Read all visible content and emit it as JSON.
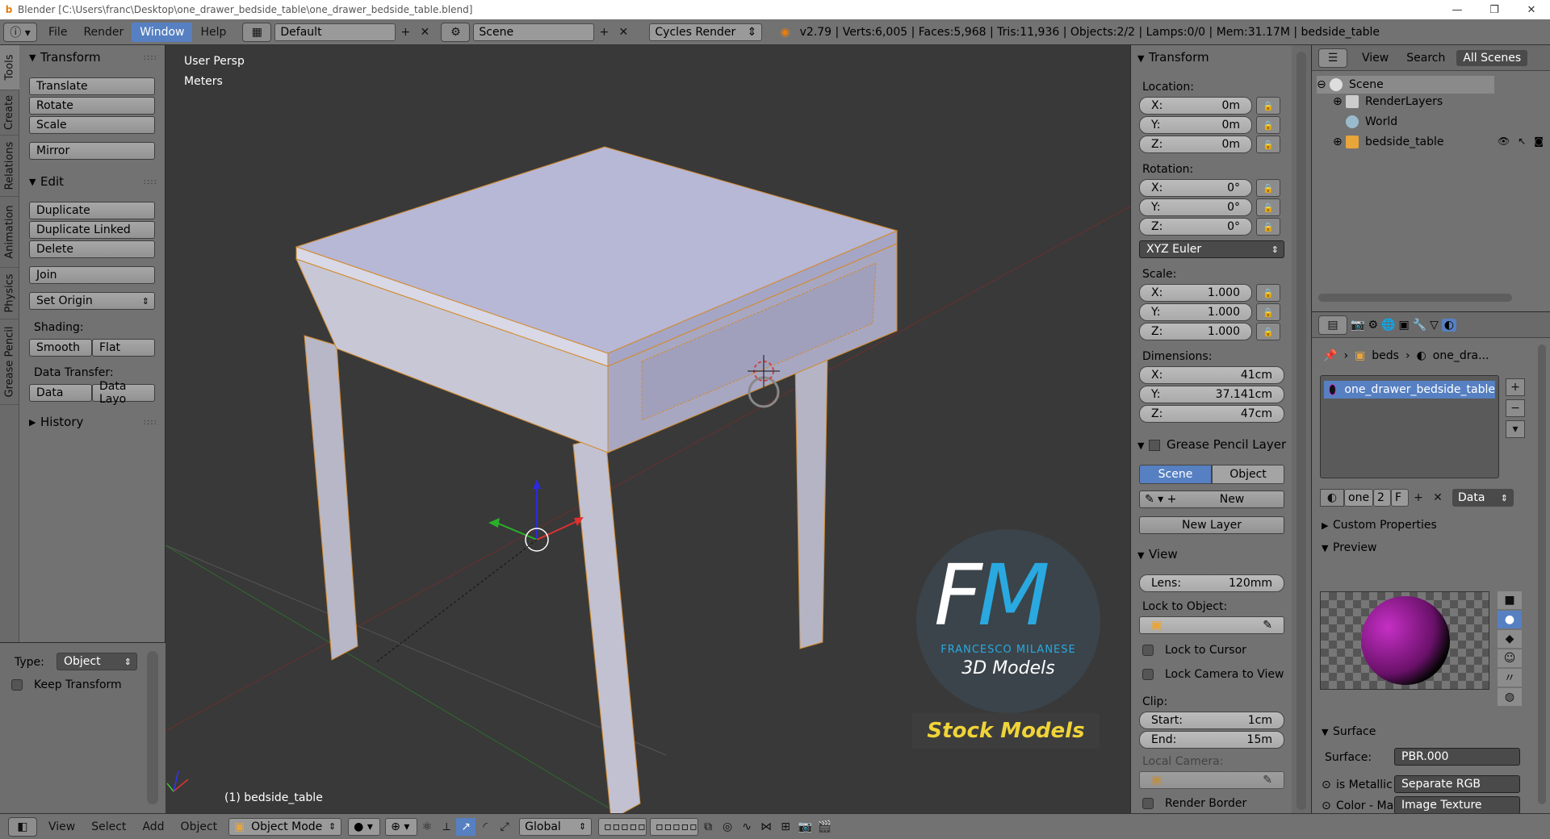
{
  "titlebar": {
    "logo": "b",
    "title": "Blender [C:\\Users\\franc\\Desktop\\one_drawer_bedside_table\\one_drawer_bedside_table.blend]",
    "minimize": "—",
    "restore": "❐",
    "close": "✕"
  },
  "topbar": {
    "menus": [
      "File",
      "Render",
      "Window",
      "Help"
    ],
    "layout": "Default",
    "scene": "Scene",
    "engine": "Cycles Render",
    "stats": "v2.79 | Verts:6,005 | Faces:5,968 | Tris:11,936 | Objects:2/2 | Lamps:0/0 | Mem:31.17M | bedside_table"
  },
  "tool_tabs": [
    "Tools",
    "Create",
    "Relations",
    "Animation",
    "Physics",
    "Grease Pencil"
  ],
  "tools": {
    "transform_header": "Transform",
    "translate": "Translate",
    "rotate": "Rotate",
    "scale": "Scale",
    "mirror": "Mirror",
    "edit_header": "Edit",
    "duplicate": "Duplicate",
    "duplicate_linked": "Duplicate Linked",
    "delete": "Delete",
    "join": "Join",
    "set_origin": "Set Origin",
    "shading_label": "Shading:",
    "smooth": "Smooth",
    "flat": "Flat",
    "data_transfer_label": "Data Transfer:",
    "data": "Data",
    "data_layout": "Data Layo",
    "history_header": "History",
    "type_label": "Type:",
    "type_value": "Object",
    "keep_transform": "Keep Transform"
  },
  "viewport": {
    "view_name": "User Persp",
    "units": "Meters",
    "object_label": "(1) bedside_table",
    "watermark": {
      "fm": "FM",
      "author": "FRANCESCO MILANESE",
      "sub": "3D Models",
      "banner": "Stock Models"
    }
  },
  "bottombar": {
    "menus": [
      "View",
      "Select",
      "Add",
      "Object"
    ],
    "mode": "Object Mode",
    "orientation": "Global"
  },
  "npanel": {
    "transform_header": "Transform",
    "location_label": "Location:",
    "location": [
      {
        "axis": "X:",
        "value": "0m"
      },
      {
        "axis": "Y:",
        "value": "0m"
      },
      {
        "axis": "Z:",
        "value": "0m"
      }
    ],
    "rotation_label": "Rotation:",
    "rotation": [
      {
        "axis": "X:",
        "value": "0°"
      },
      {
        "axis": "Y:",
        "value": "0°"
      },
      {
        "axis": "Z:",
        "value": "0°"
      }
    ],
    "rotation_mode": "XYZ Euler",
    "scale_label": "Scale:",
    "scale": [
      {
        "axis": "X:",
        "value": "1.000"
      },
      {
        "axis": "Y:",
        "value": "1.000"
      },
      {
        "axis": "Z:",
        "value": "1.000"
      }
    ],
    "dimensions_label": "Dimensions:",
    "dimensions": [
      {
        "axis": "X:",
        "value": "41cm"
      },
      {
        "axis": "Y:",
        "value": "37.141cm"
      },
      {
        "axis": "Z:",
        "value": "47cm"
      }
    ],
    "gp_header": "Grease Pencil Layer",
    "gp_scene": "Scene",
    "gp_object": "Object",
    "gp_new": "New",
    "gp_new_layer": "New Layer",
    "view_header": "View",
    "lens_label": "Lens:",
    "lens_value": "120mm",
    "lock_object_label": "Lock to Object:",
    "lock_cursor": "Lock to Cursor",
    "lock_camera": "Lock Camera to View",
    "clip_label": "Clip:",
    "clip_start_label": "Start:",
    "clip_start": "1cm",
    "clip_end_label": "End:",
    "clip_end": "15m",
    "local_camera_label": "Local Camera:",
    "render_border": "Render Border"
  },
  "outliner": {
    "view": "View",
    "search": "Search",
    "all_scenes": "All Scenes",
    "items": [
      {
        "label": "Scene"
      },
      {
        "label": "RenderLayers"
      },
      {
        "label": "World"
      },
      {
        "label": "bedside_table"
      }
    ]
  },
  "properties": {
    "breadcrumb_1": "beds",
    "breadcrumb_2": "one_dra...",
    "material_slot": "one_drawer_bedside_table",
    "mat_name": "one",
    "mat_users": "2",
    "mat_fake": "F",
    "mat_link": "Data",
    "custom_props": "Custom Properties",
    "preview": "Preview",
    "surface_header": "Surface",
    "surface_label": "Surface:",
    "surface_value": "PBR.000",
    "is_metallic_label": "is Metallic",
    "is_metallic_value": "Separate RGB",
    "color_label": "Color - Ma",
    "color_value": "Image Texture"
  }
}
